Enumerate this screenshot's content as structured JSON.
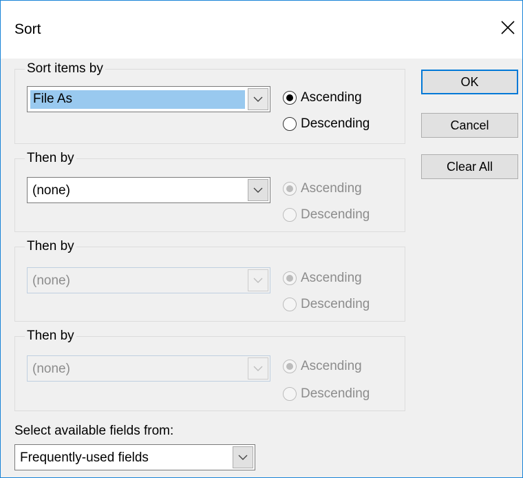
{
  "dialog": {
    "title": "Sort"
  },
  "groups": [
    {
      "legend": "Sort items by",
      "value": "File As",
      "ascending": "Ascending",
      "descending": "Descending",
      "selected": "ascending"
    },
    {
      "legend": "Then by",
      "value": "(none)",
      "ascending": "Ascending",
      "descending": "Descending",
      "selected": "ascending"
    },
    {
      "legend": "Then by",
      "value": "(none)",
      "ascending": "Ascending",
      "descending": "Descending",
      "selected": "ascending"
    },
    {
      "legend": "Then by",
      "value": "(none)",
      "ascending": "Ascending",
      "descending": "Descending",
      "selected": "ascending"
    }
  ],
  "buttons": {
    "ok": "OK",
    "cancel": "Cancel",
    "clear_all": "Clear All"
  },
  "fields_from": {
    "label": "Select available fields from:",
    "value": "Frequently-used fields"
  },
  "colors": {
    "accent": "#0078d7",
    "border": "#1883d7",
    "selection": "#99c9ef",
    "disabled_text": "#8c8c8c"
  }
}
